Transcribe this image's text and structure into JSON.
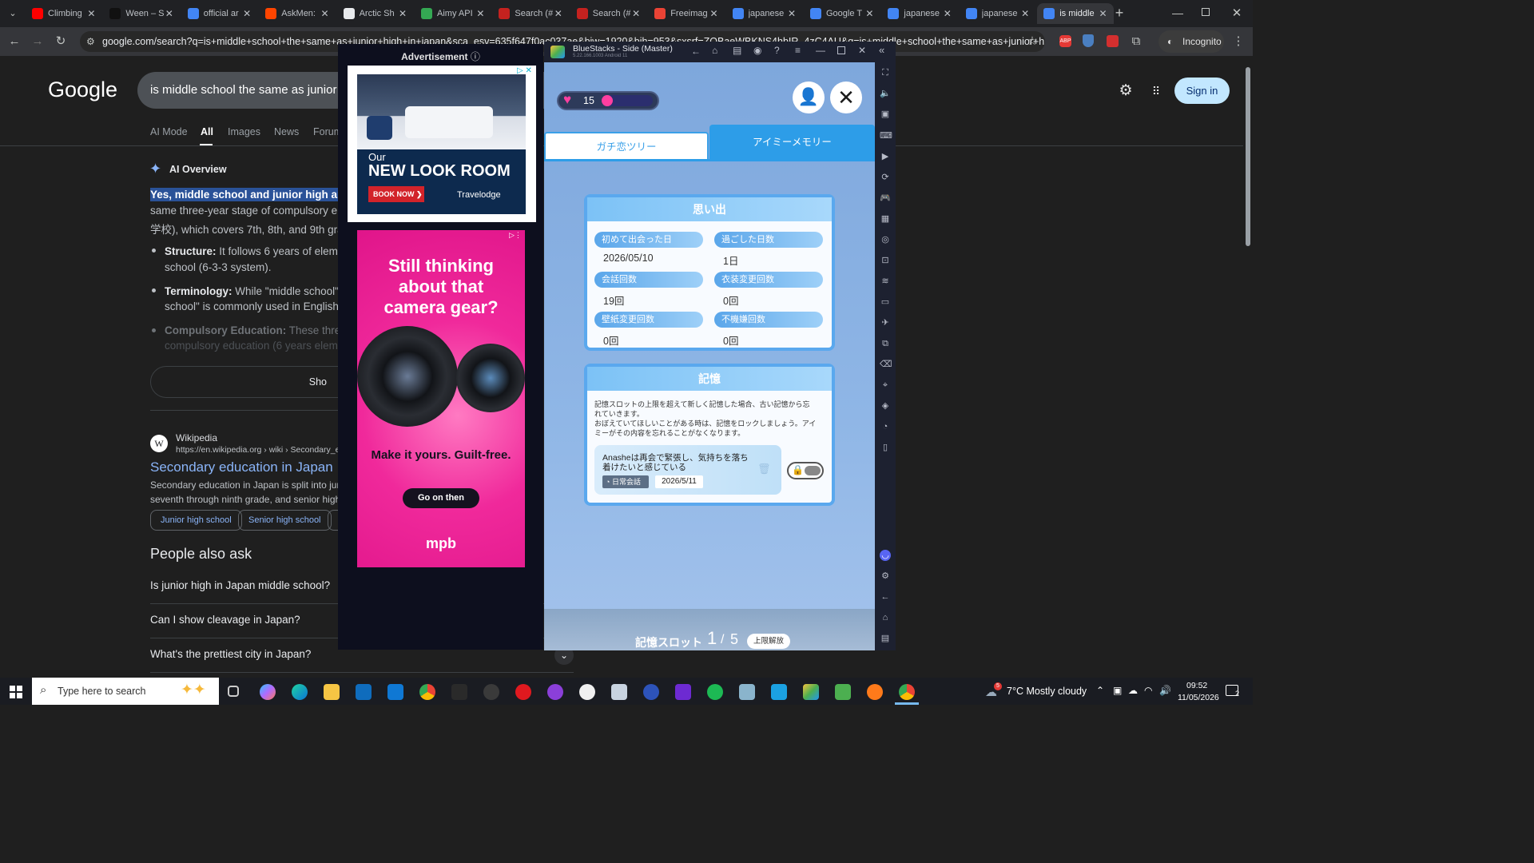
{
  "browser": {
    "tabs": [
      {
        "label": "Climbing",
        "color": "#ff0000"
      },
      {
        "label": "Ween – S",
        "color": "#111111"
      },
      {
        "label": "official ar",
        "color": "#4285f4"
      },
      {
        "label": "AskMen:",
        "color": "#ff4500"
      },
      {
        "label": "Arctic Sh",
        "color": "#e8eaed"
      },
      {
        "label": "Aimy API",
        "color": "#34a853"
      },
      {
        "label": "Search (#",
        "color": "#c5221f"
      },
      {
        "label": "Search (#",
        "color": "#c5221f"
      },
      {
        "label": "Freeimag",
        "color": "#ea4335"
      },
      {
        "label": "japanese",
        "color": "#4285f4"
      },
      {
        "label": "Google T",
        "color": "#4285f4"
      },
      {
        "label": "japanese",
        "color": "#4285f4"
      },
      {
        "label": "japanese",
        "color": "#4285f4"
      },
      {
        "label": "is middle",
        "color": "#4285f4"
      }
    ],
    "url": "google.com/search?q=is+middle+school+the+same+as+junior+high+in+japan&sca_esv=635f647f0ac037ae&biw=1920&bih=953&sxsrf=ZOBaeWBKNS4hbIR_4zC4AU&q=is+middle+school+the+same+as+junior+high+in+ja...",
    "incognito_label": "Incognito"
  },
  "google": {
    "logo": "Google",
    "query": "is middle school the same as junior high",
    "tabs": [
      "AI Mode",
      "All",
      "Images",
      "News",
      "Forum"
    ],
    "sign_in": "Sign in",
    "ai_overview": {
      "title": "AI Overview",
      "highlight": "Yes, middle school and junior high are",
      "line2": "same three-year stage of compulsory e",
      "line3": "学校), which covers 7th, 8th, and 9th gra",
      "bullet1_bold": "Structure:",
      "bullet1_rest": " It follows 6 years of eleme",
      "bullet1_line2": "school (6-3-3 system).",
      "bullet2_bold": "Terminology:",
      "bullet2_rest": " While \"middle school\"",
      "bullet2_line2": "school\" is commonly used in English",
      "bullet3_bold": "Compulsory Education:",
      "bullet3_rest": " These three",
      "bullet3_line2": "compulsory education (6 years elem",
      "show_more": "Sho"
    },
    "result": {
      "site": "Wikipedia",
      "url": "https://en.wikipedia.org › wiki › Secondary_edu",
      "title": "Secondary education in Japan",
      "snippet1": "Secondary education in Japan is split into juni",
      "snippet2": "seventh through ninth grade, and senior high s",
      "chips": [
        "Junior high school",
        "Senior high school"
      ]
    },
    "paa": {
      "title": "People also ask",
      "questions": [
        "Is junior high in Japan middle school?",
        "Can I show cleavage in Japan?",
        "What's the prettiest city in Japan?"
      ]
    }
  },
  "ads": {
    "header": "Advertisement",
    "ad1": {
      "line1": "Our",
      "line2": "NEW LOOK ROOM",
      "cta": "BOOK NOW",
      "brand": "Travelodge"
    },
    "ad2": {
      "headline": "Still thinking about that camera gear?",
      "sub": "Make it yours. Guilt-free.",
      "cta": "Go on then",
      "brand": "mpb"
    }
  },
  "bluestacks": {
    "title": "BlueStacks - Side (Master)",
    "version": "5.22.166.1003  Android 11",
    "hearts": "15",
    "tabs": [
      "ガチ恋ツリー",
      "アイミーメモリー"
    ],
    "memories": {
      "title": "思い出",
      "items": [
        {
          "label": "初めて出会った日",
          "value": "2026/05/10"
        },
        {
          "label": "過ごした日数",
          "value": "1日"
        },
        {
          "label": "会話回数",
          "value": "19回"
        },
        {
          "label": "衣装変更回数",
          "value": "0回"
        },
        {
          "label": "壁紙変更回数",
          "value": "0回"
        },
        {
          "label": "不機嫌回数",
          "value": "0回"
        }
      ]
    },
    "memory": {
      "title": "記憶",
      "desc1": "記憶スロットの上限を超えて新しく記憶した場合、古い記憶から忘",
      "desc2": "れていきます。",
      "desc3": "おぼえていてほしいことがある時は、記憶をロックしましょう。アイ",
      "desc4": "ミーがその内容を忘れることがなくなります。",
      "card_text1": "Anasheは再会で緊張し、気持ちを落ち",
      "card_text2": "着けたいと感じている",
      "card_tag": "日常会話",
      "card_date": "2026/5/11"
    },
    "slot": {
      "label": "記憶スロット",
      "current": "1",
      "sep": "/",
      "max": "5",
      "button": "上限解放"
    }
  },
  "taskbar": {
    "search_placeholder": "Type here to search",
    "weather": "7°C  Mostly cloudy",
    "weather_badge": "5",
    "time": "09:52",
    "date": "11/05/2026",
    "notif": "2"
  }
}
